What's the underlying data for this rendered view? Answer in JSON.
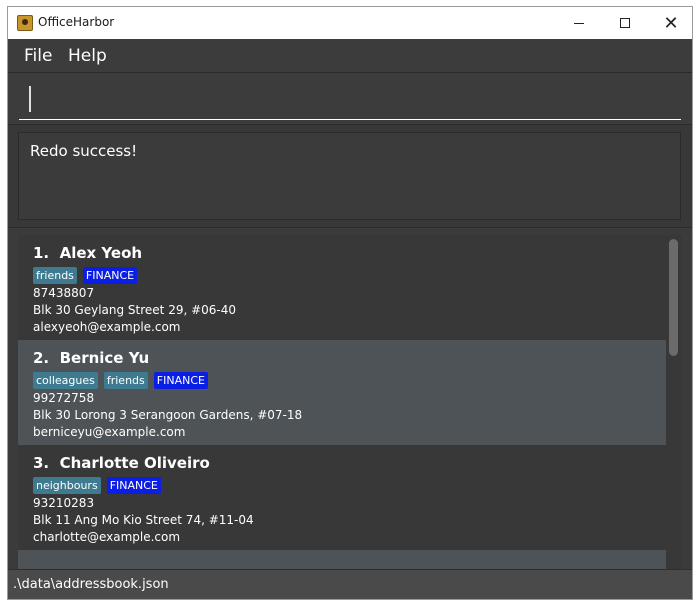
{
  "window": {
    "title": "OfficeHarbor"
  },
  "menu": {
    "file": "File",
    "help": "Help"
  },
  "command": {
    "value": ""
  },
  "result": {
    "text": "Redo success!"
  },
  "persons": [
    {
      "index": "1.",
      "name": "Alex Yeoh",
      "tags": [
        "friends"
      ],
      "department": "FINANCE",
      "phone": "87438807",
      "address": "Blk 30 Geylang Street 29, #06-40",
      "email": "alexyeoh@example.com"
    },
    {
      "index": "2.",
      "name": "Bernice Yu",
      "tags": [
        "colleagues",
        "friends"
      ],
      "department": "FINANCE",
      "phone": "99272758",
      "address": "Blk 30 Lorong 3 Serangoon Gardens, #07-18",
      "email": "berniceyu@example.com"
    },
    {
      "index": "3.",
      "name": "Charlotte Oliveiro",
      "tags": [
        "neighbours"
      ],
      "department": "FINANCE",
      "phone": "93210283",
      "address": "Blk 11 Ang Mo Kio Street 74, #11-04",
      "email": "charlotte@example.com"
    }
  ],
  "status": {
    "path": ".\\data\\addressbook.json"
  },
  "colors": {
    "tag": "#3e7b91",
    "finance_tag": "#0b1ee6",
    "card_alt": "#4d5356"
  }
}
